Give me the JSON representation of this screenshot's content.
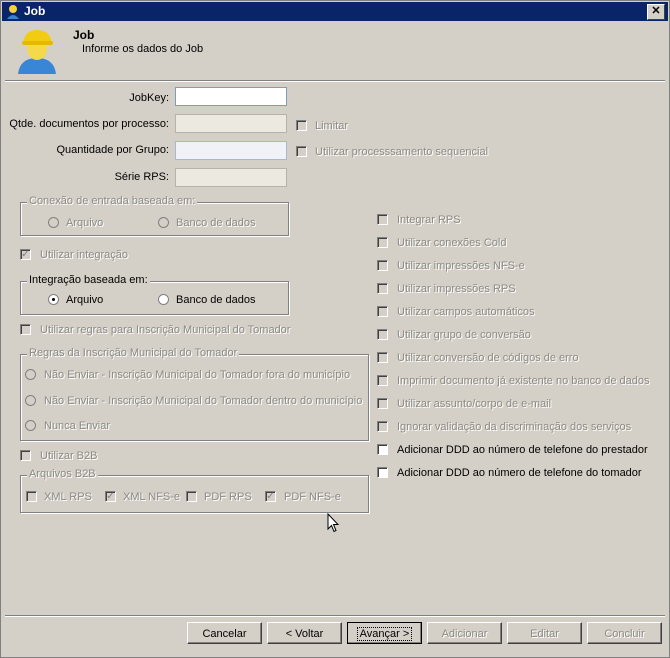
{
  "window": {
    "title": "Job",
    "close": "✕"
  },
  "header": {
    "title": "Job",
    "subtitle": "Informe os dados do Job"
  },
  "fields": {
    "jobkey": "JobKey:",
    "qtde": "Qtde. documentos por processo:",
    "qtd_grupo": "Quantidade por Grupo:",
    "serie": "Série RPS:"
  },
  "checks": {
    "limitar": "Limitar",
    "sequencial": "Utilizar processsamento sequencial",
    "integracao": "Utilizar integração",
    "regras": "Utilizar regras para Inscrição Municipal do Tomador",
    "b2b": "Utilizar B2B"
  },
  "conexao": {
    "title": "Conexão de entrada baseada em:",
    "arquivo": "Arquivo",
    "banco": "Banco de dados"
  },
  "integracao_grp": {
    "title": "Integração baseada em:",
    "arquivo": "Arquivo",
    "banco": "Banco de dados"
  },
  "regras_grp": {
    "title": "Regras da Inscrição Municipal do Tomador",
    "opt1": "Não Enviar - Inscrição Municipal do Tomador fora do município",
    "opt2": "Não Enviar - Inscrição Municipal do Tomador dentro do município",
    "opt3": "Nunca Enviar"
  },
  "b2b_grp": {
    "title": "Arquivos B2B",
    "xml_rps": "XML RPS",
    "xml_nfse": "XML NFS-e",
    "pdf_rps": "PDF RPS",
    "pdf_nfse": "PDF NFS-e"
  },
  "right": [
    {
      "label": "Integrar RPS",
      "enabled": false
    },
    {
      "label": "Utilizar conexões Cold",
      "enabled": false
    },
    {
      "label": "Utilizar impressões NFS-e",
      "enabled": false
    },
    {
      "label": "Utilizar impressões RPS",
      "enabled": false
    },
    {
      "label": "Utilizar campos automáticos",
      "enabled": false
    },
    {
      "label": "Utilizar grupo de conversão",
      "enabled": false
    },
    {
      "label": "Utilizar conversão de códigos de erro",
      "enabled": false
    },
    {
      "label": "Imprimir documento já existente no banco de dados",
      "enabled": false
    },
    {
      "label": "Utilizar assunto/corpo de e-mail",
      "enabled": false
    },
    {
      "label": "Ignorar validação da discriminação dos serviços",
      "enabled": false
    },
    {
      "label": "Adicionar DDD ao número de telefone do prestador",
      "enabled": true
    },
    {
      "label": "Adicionar DDD ao número de telefone do tomador",
      "enabled": true
    }
  ],
  "buttons": {
    "cancelar": "Cancelar",
    "voltar": "< Voltar",
    "avancar": "Avançar >",
    "adicionar": "Adicionar",
    "editar": "Editar",
    "concluir": "Concluir"
  }
}
